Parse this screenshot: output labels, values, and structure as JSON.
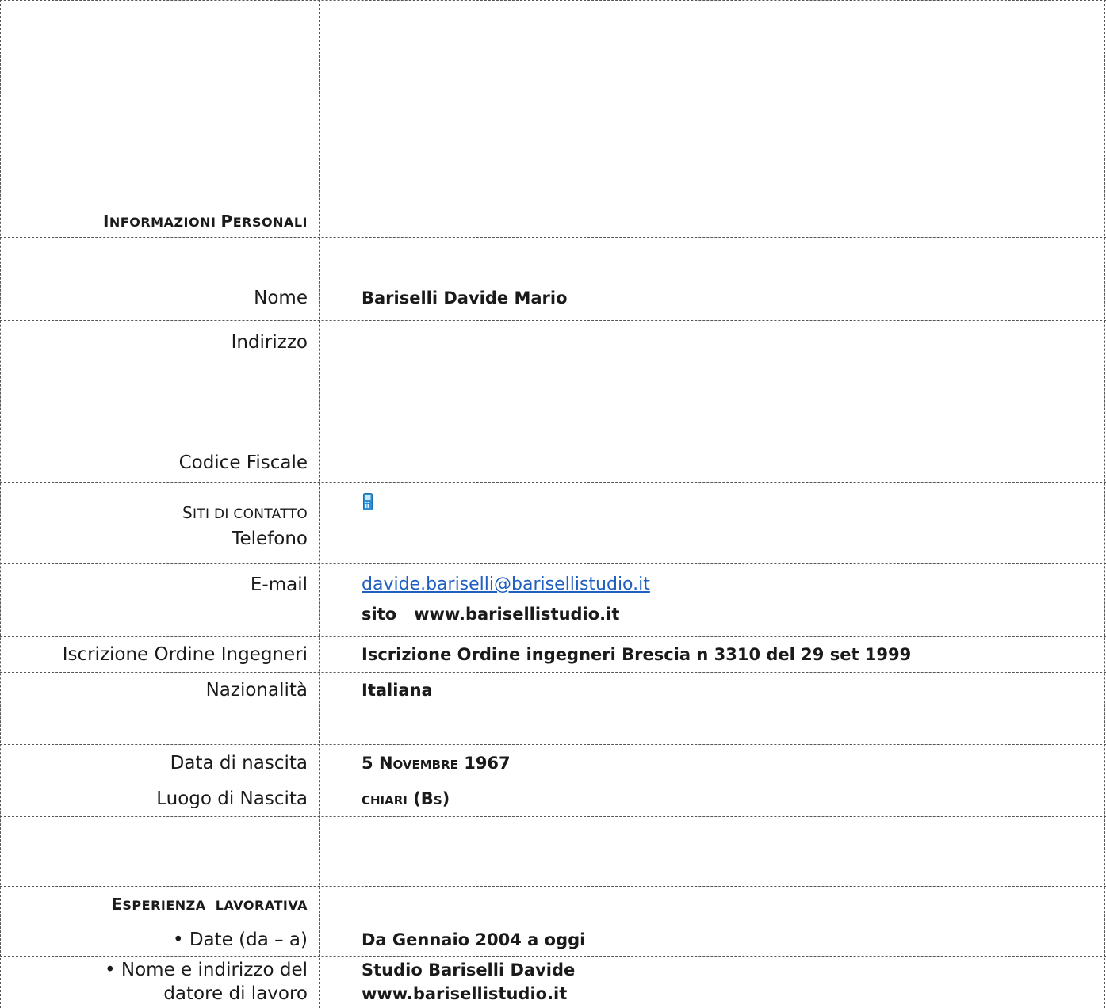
{
  "sections": {
    "personal": {
      "pre": "I",
      "caps": "NFORMAZIONI",
      "pre2": "P",
      "caps2": "ERSONALI"
    },
    "experience": {
      "pre": "E",
      "caps": "SPERIENZA",
      "pre2": "",
      "caps2": "LAVORATIVA"
    }
  },
  "fields": {
    "nome": {
      "label": "Nome",
      "value": "Bariselli Davide Mario"
    },
    "indirizzo": {
      "label": "Indirizzo"
    },
    "codice_fiscale": {
      "label": "Codice Fiscale"
    },
    "siti": {
      "pre": "S",
      "caps": "ITI DI CONTATTO"
    },
    "telefono": {
      "label": "Telefono",
      "icon": "mobile-phone-icon"
    },
    "email": {
      "label": "E-mail",
      "value": "davide.bariselli@barisellistudio.it"
    },
    "sito": {
      "prefix": "sito",
      "value": "www.barisellistudio.it"
    },
    "iscrizione": {
      "label": "Iscrizione Ordine Ingegneri",
      "value": "Iscrizione Ordine ingegneri Brescia n 3310 del 29 set 1999"
    },
    "nazionalita": {
      "label": "Nazionalità",
      "value": "Italiana"
    },
    "data_nascita": {
      "label": "Data di nascita",
      "day": "5",
      "mpre": "N",
      "mcaps": "OVEMBRE",
      "year": "1967"
    },
    "luogo_nascita": {
      "label": "Luogo di Nascita",
      "city": "CHIARI",
      "prov_pre": "(B",
      "prov_caps": "S",
      "prov_post": ")"
    },
    "date": {
      "label": "• Date (da – a)",
      "value": "Da Gennaio 2004 a oggi"
    },
    "datore": {
      "label_line1": "• Nome e indirizzo del",
      "label_line2": "datore di lavoro",
      "value_line1": "Studio Bariselli Davide",
      "value_line2": "www.barisellistudio.it"
    }
  },
  "colors": {
    "link": "#1f5fbf",
    "phone_icon": "#2d8fd5",
    "border": "#555555"
  }
}
